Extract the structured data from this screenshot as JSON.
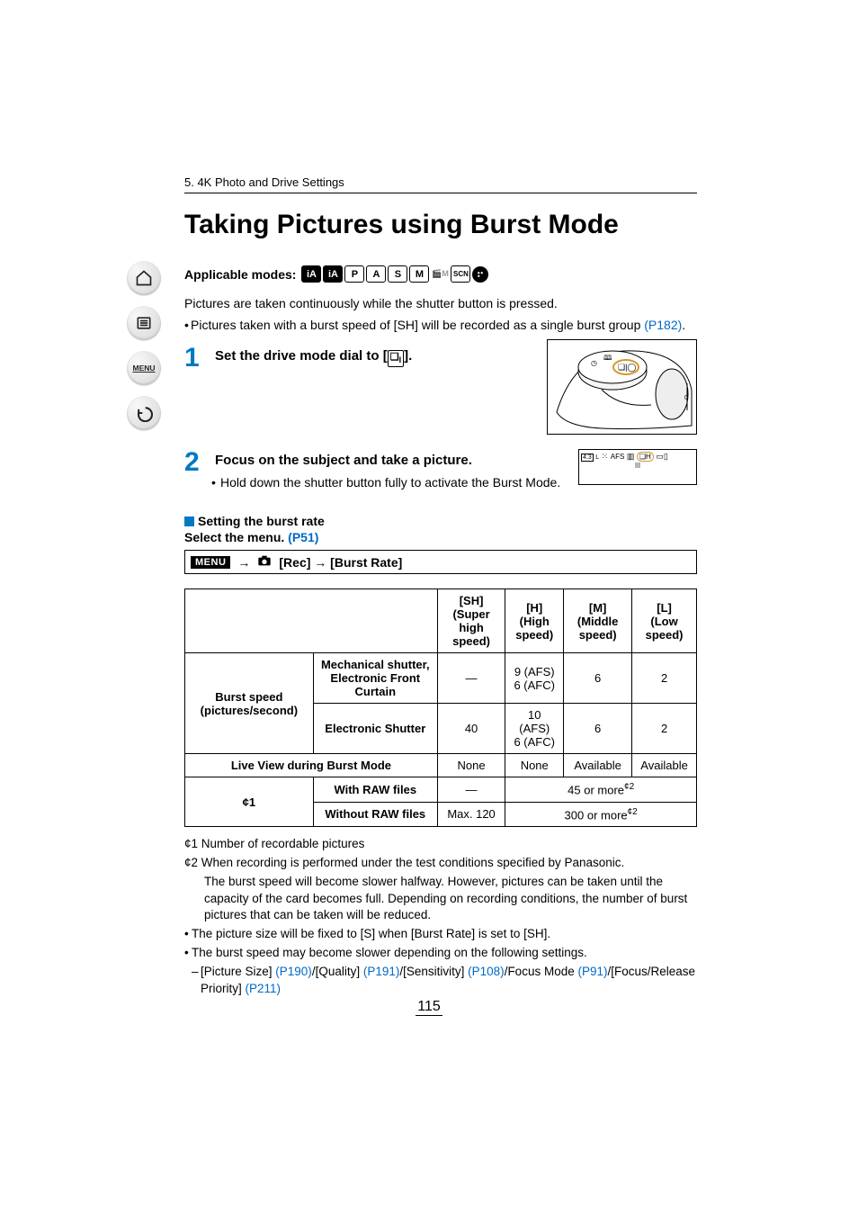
{
  "breadcrumb": "5. 4K Photo and Drive Settings",
  "title": "Taking Pictures using Burst Mode",
  "applicable_label": "Applicable modes:",
  "mode_icons": [
    "iA",
    "iA+",
    "P",
    "A",
    "S",
    "M",
    "🎬M",
    "SCN",
    "🎨"
  ],
  "intro": "Pictures are taken continuously while the shutter button is pressed.",
  "intro_bullet_pre": "Pictures taken with a burst speed of [SH] will be recorded as a single burst group ",
  "intro_bullet_link": "(P182)",
  "intro_bullet_post": ".",
  "steps": [
    {
      "num": "1",
      "title_pre": "Set the drive mode dial to [",
      "title_post": "].",
      "icon": "burst-icon"
    },
    {
      "num": "2",
      "title": "Focus on the subject and take a picture.",
      "sub": "Hold down the shutter button fully to activate the Burst Mode."
    }
  ],
  "lcd_text": "4:3 L ▦ AFS ▥ ⬚H ▭",
  "setting_head": "Setting the burst rate",
  "select_menu_pre": "Select the menu. ",
  "select_menu_link": "(P51)",
  "menu_label": "MENU",
  "menu_path": "[Rec] → [Burst Rate]",
  "rec_icon": "📷",
  "table": {
    "headers": [
      "",
      "",
      "[SH]\n(Super high speed)",
      "[H]\n(High speed)",
      "[M]\n(Middle speed)",
      "[L]\n(Low speed)"
    ],
    "rows": [
      {
        "label": "Burst speed (pictures/second)",
        "sub": "Mechanical shutter, Electronic Front Curtain",
        "cells": [
          "—",
          "9 (AFS)\n6 (AFC)",
          "6",
          "2"
        ]
      },
      {
        "sub": "Electronic Shutter",
        "cells": [
          "40",
          "10 (AFS)\n6 (AFC)",
          "6",
          "2"
        ]
      }
    ],
    "liveview": {
      "label": "Live View during Burst Mode",
      "cells": [
        "None",
        "None",
        "Available",
        "Available"
      ]
    },
    "star": {
      "label": "¢1",
      "row1": {
        "sub": "With RAW files",
        "c1": "—",
        "rest": "45 or more",
        "sup": "¢2"
      },
      "row2": {
        "sub": "Without RAW files",
        "c1": "Max. 120",
        "rest": "300 or more",
        "sup": "¢2"
      }
    }
  },
  "footnotes": {
    "f1": "¢1 Number of recordable pictures",
    "f2a": "¢2 When recording is performed under the test conditions specified by Panasonic.",
    "f2b": "The burst speed will become slower halfway. However, pictures can be taken until the capacity of the card becomes full. Depending on recording conditions, the number of burst pictures that can be taken will be reduced.",
    "b1": "The picture size will be fixed to [S] when [Burst Rate] is set to [SH].",
    "b2": "The burst speed may become slower depending on the following settings.",
    "dash_pre": "[Picture Size] ",
    "l1": "(P190)",
    "m1": "/[Quality] ",
    "l2": "(P191)",
    "m2": "/[Sensitivity] ",
    "l3": "(P108)",
    "m3": "/Focus Mode ",
    "l4": "(P91)",
    "m4": "/[Focus/Release Priority] ",
    "l5": "(P211)"
  },
  "page_number": "115"
}
